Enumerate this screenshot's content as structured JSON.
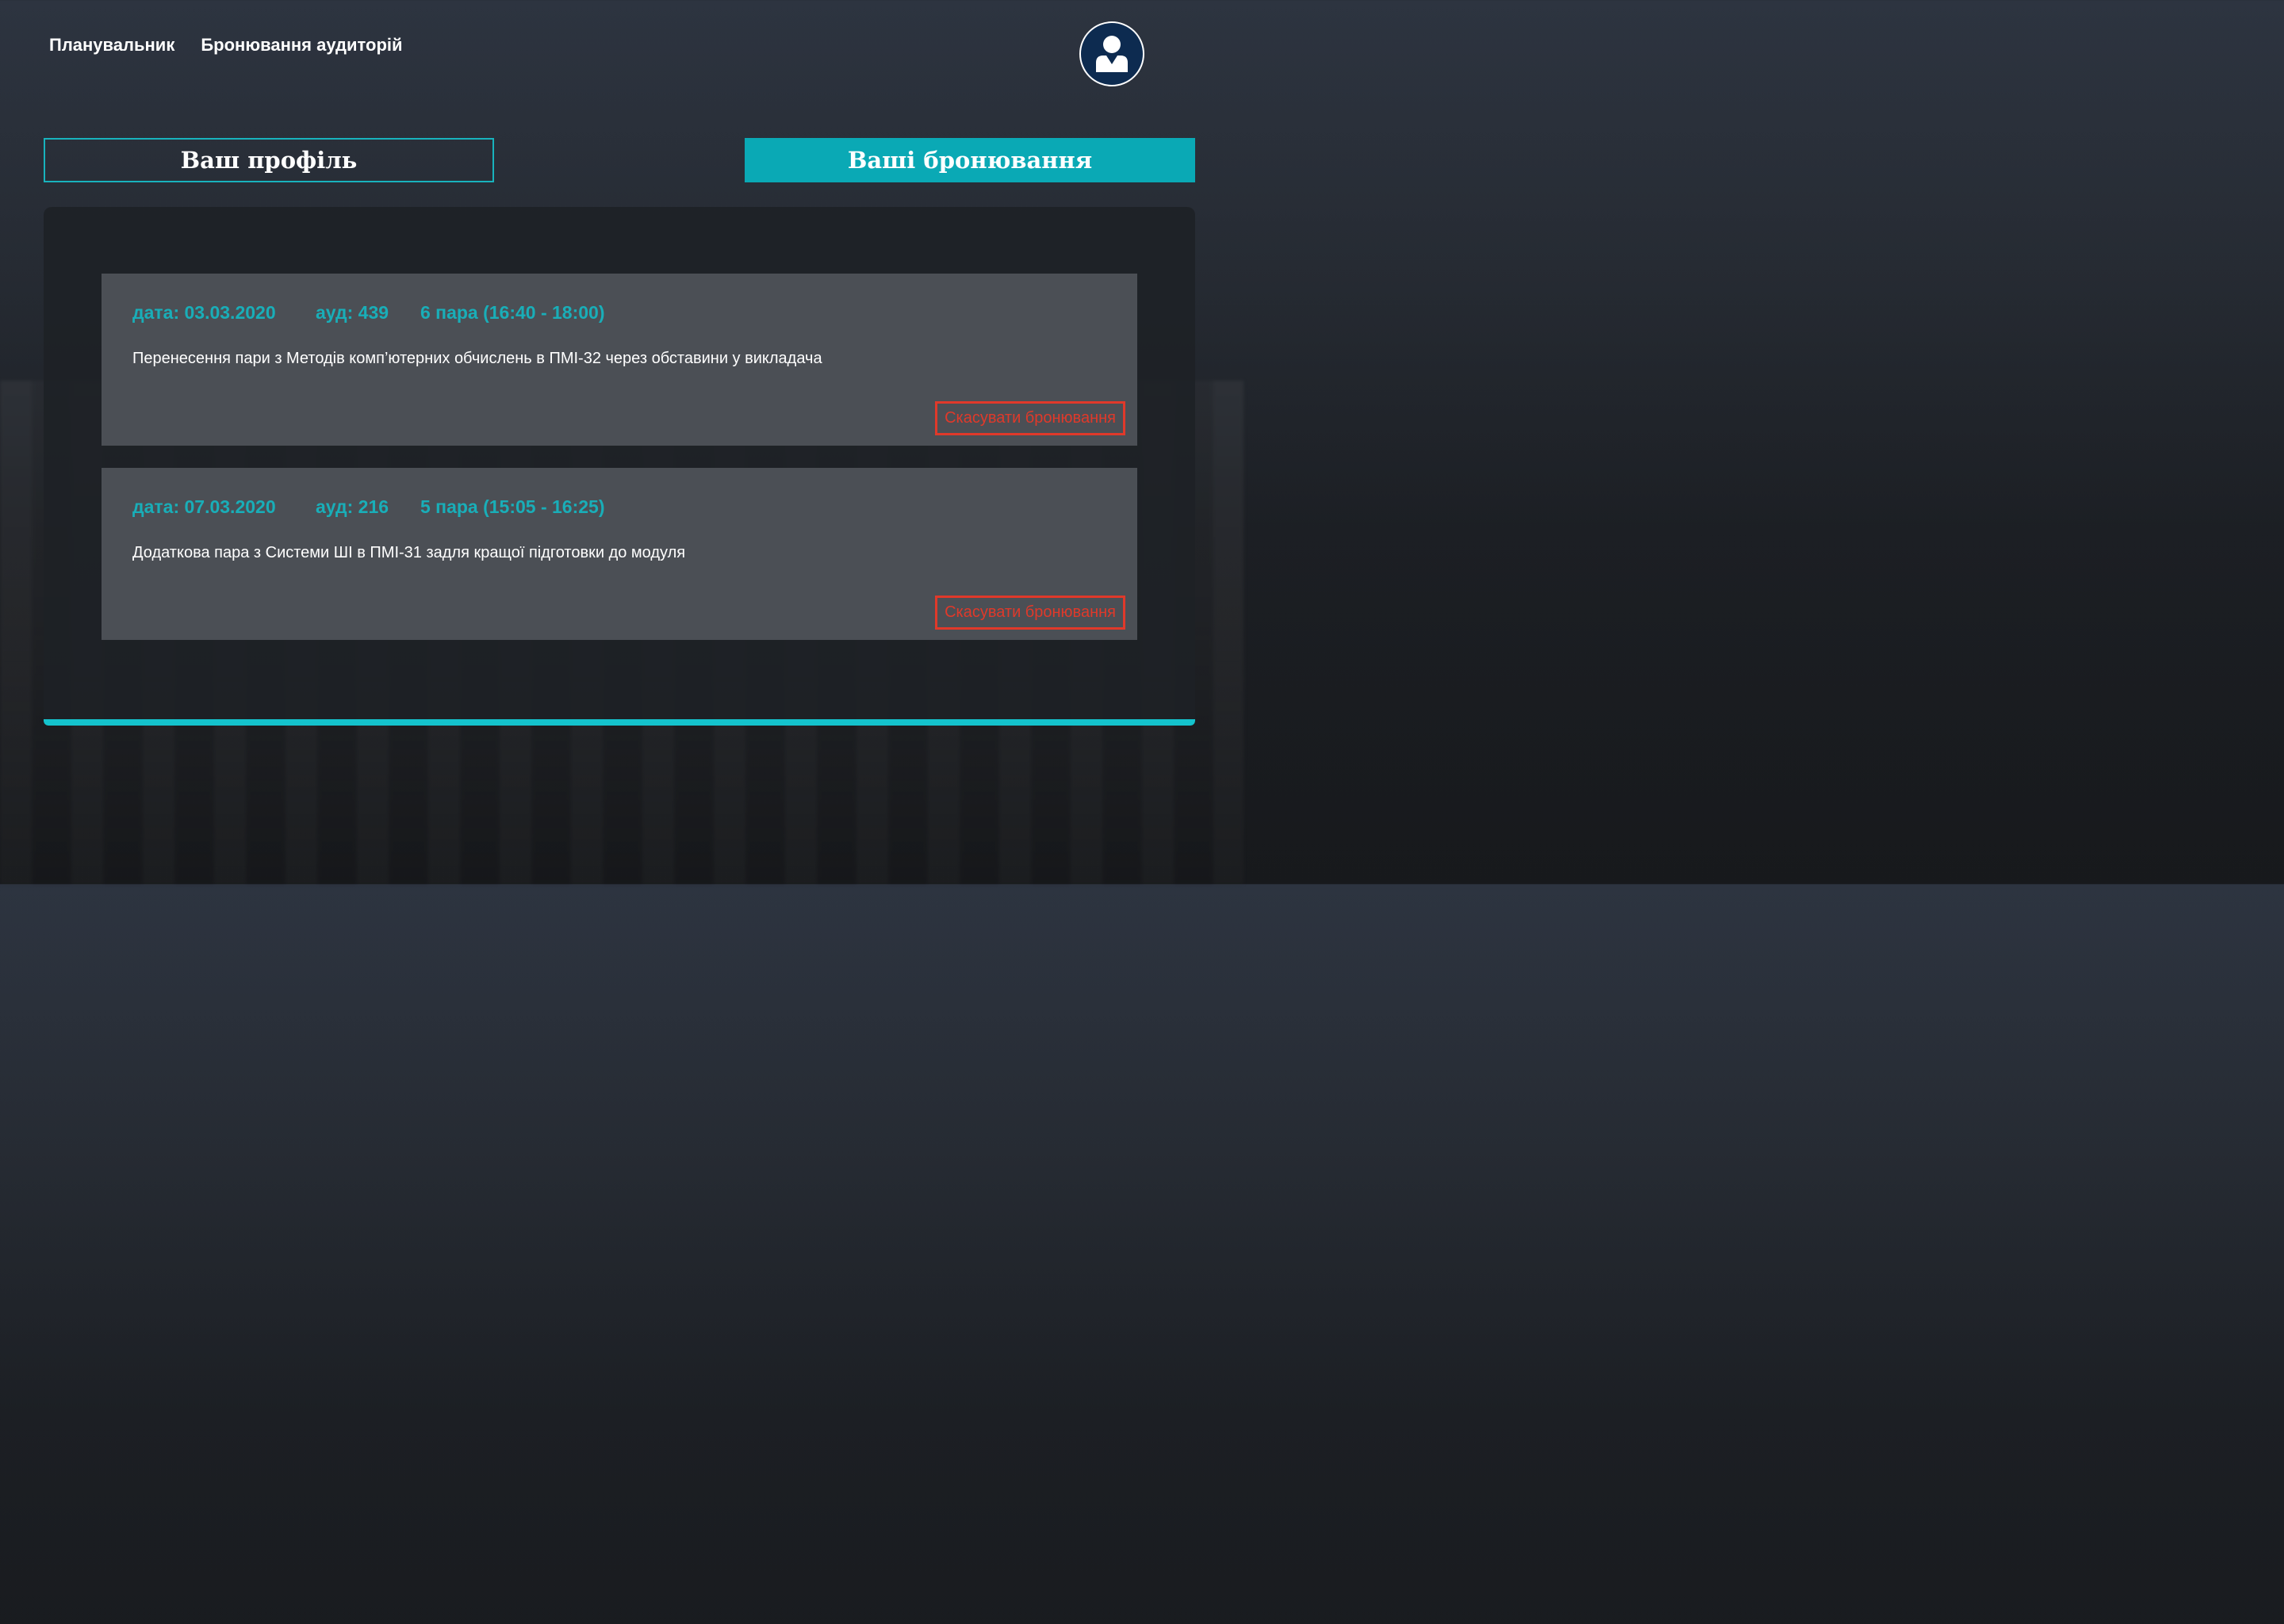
{
  "nav": {
    "items": [
      {
        "label": "Планувальник"
      },
      {
        "label": "Бронювання аудиторій"
      }
    ]
  },
  "header": {
    "avatar_icon": "user-icon"
  },
  "tabs": [
    {
      "label": "Ваш профіль",
      "active": false
    },
    {
      "label": "Ваші бронювання",
      "active": true
    }
  ],
  "bookings": [
    {
      "date": "дата: 03.03.2020",
      "room": "ауд: 439",
      "period": "6 пара (16:40 - 18:00)",
      "description": "Перенесення пари з Методів комп’ютерних обчислень в ПМІ-32 через обставини у викладача",
      "cancel_label": "Скасувати бронювання"
    },
    {
      "date": "дата: 07.03.2020",
      "room": "ауд: 216",
      "period": "5 пара (15:05 - 16:25)",
      "description": "Додаткова пара з Системи ШІ в ПМІ-31 задля кращої підготовки до модуля",
      "cancel_label": "Скасувати бронювання"
    }
  ],
  "colors": {
    "accent": "#0aa9b5",
    "cancel": "#e0392a",
    "avatar_bg": "#0d2b50"
  }
}
